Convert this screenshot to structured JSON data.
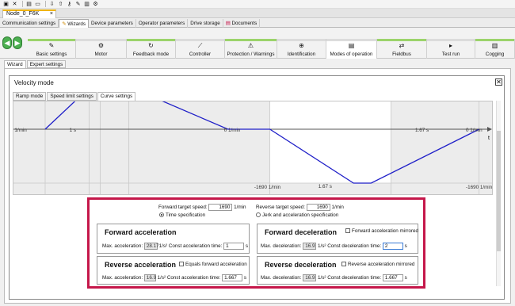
{
  "document_tab": {
    "title": "Node_0_F6K",
    "close": "×"
  },
  "main_tabs": [
    "Communication settings",
    "Wizards",
    "Device parameters",
    "Operator parameters",
    "Drive storage",
    "Documents"
  ],
  "wizard_steps": [
    {
      "label": "Basic settings",
      "status": "#9bd36b",
      "icon": "✎"
    },
    {
      "label": "Motor",
      "status": "#dcdcdc",
      "icon": "⚙"
    },
    {
      "label": "Feedback mode",
      "status": "#9bd36b",
      "icon": "↻"
    },
    {
      "label": "Controller",
      "status": "#dcdcdc",
      "icon": "⟋"
    },
    {
      "label": "Protection / Warnings",
      "status": "#9bd36b",
      "icon": "⚠"
    },
    {
      "label": "Identification",
      "status": "#dcdcdc",
      "icon": "⊕"
    },
    {
      "label": "Modes of operation",
      "status": "#dcdcdc",
      "icon": "▤"
    },
    {
      "label": "Fieldbus",
      "status": "#9bd36b",
      "icon": "⇄"
    },
    {
      "label": "Test run",
      "status": "#dcdcdc",
      "icon": "▸"
    },
    {
      "label": "Cogging",
      "status": "#9bd36b",
      "icon": "▥"
    }
  ],
  "sub_tabs": [
    "Wizard",
    "Expert settings"
  ],
  "velocity": {
    "title": "Velocity mode",
    "close": "✕",
    "tabs": [
      "Ramp mode",
      "Speed limit settings",
      "Curve settings"
    ]
  },
  "chart_data": {
    "type": "line",
    "x_axis_symbol": "t",
    "segments": [
      {
        "x": [
          0,
          1,
          2.6,
          4.6,
          5.6,
          6.8,
          7.9,
          8.05,
          9.72
        ],
        "y": [
          0,
          1690,
          1690,
          0,
          -1690,
          -1690,
          0,
          0,
          0
        ]
      }
    ],
    "labels": [
      {
        "text": "0 1/min",
        "role": "start-speed"
      },
      {
        "text": "1 s",
        "role": "accel-time"
      },
      {
        "text": "0 1/min",
        "role": "mid-zero"
      },
      {
        "text": "-1690 1/min",
        "role": "reverse-speed"
      },
      {
        "text": "1.67 s",
        "role": "reverse-decel-time"
      },
      {
        "text": "1.67 s",
        "role": "reverse-accel-time"
      },
      {
        "text": "0 1/min",
        "role": "end-speed"
      },
      {
        "text": "-1690 1/min",
        "role": "end-reverse-speed"
      }
    ]
  },
  "settings": {
    "forward_target_label": "Forward target speed:",
    "forward_target_value": "1690",
    "unit_speed": "1/min",
    "reverse_target_label": "Reverse target speed:",
    "reverse_target_value": "1690",
    "time_spec_label": "Time specification",
    "jerk_spec_label": "Jerk and acceleration specification",
    "fa": {
      "title": "Forward acceleration",
      "max_label": "Max. acceleration:",
      "max_value": "28.17",
      "unit": "1/s²",
      "const_label": "Const acceleration time:",
      "const_value": "1",
      "const_unit": "s"
    },
    "fd": {
      "title": "Forward deceleration",
      "mirror_label": "Forward acceleration mirrored",
      "max_label": "Max. deceleration:",
      "max_value": "16.9",
      "unit": "1/s²",
      "const_label": "Const deceleration time:",
      "const_value": "2",
      "const_unit": "s"
    },
    "ra": {
      "title": "Reverse acceleration",
      "equals_label": "Equals forward acceleration",
      "max_label": "Max. acceleration:",
      "max_value": "16.9",
      "unit": "1/s²",
      "const_label": "Const acceleration time:",
      "const_value": "1.667",
      "const_unit": "s"
    },
    "rd": {
      "title": "Reverse deceleration",
      "mirror_label": "Reverse acceleration mirrored",
      "max_label": "Max. deceleration:",
      "max_value": "16.9",
      "unit": "1/s²",
      "const_label": "Const deceleration time:",
      "const_value": "1.667",
      "const_unit": "s"
    }
  }
}
